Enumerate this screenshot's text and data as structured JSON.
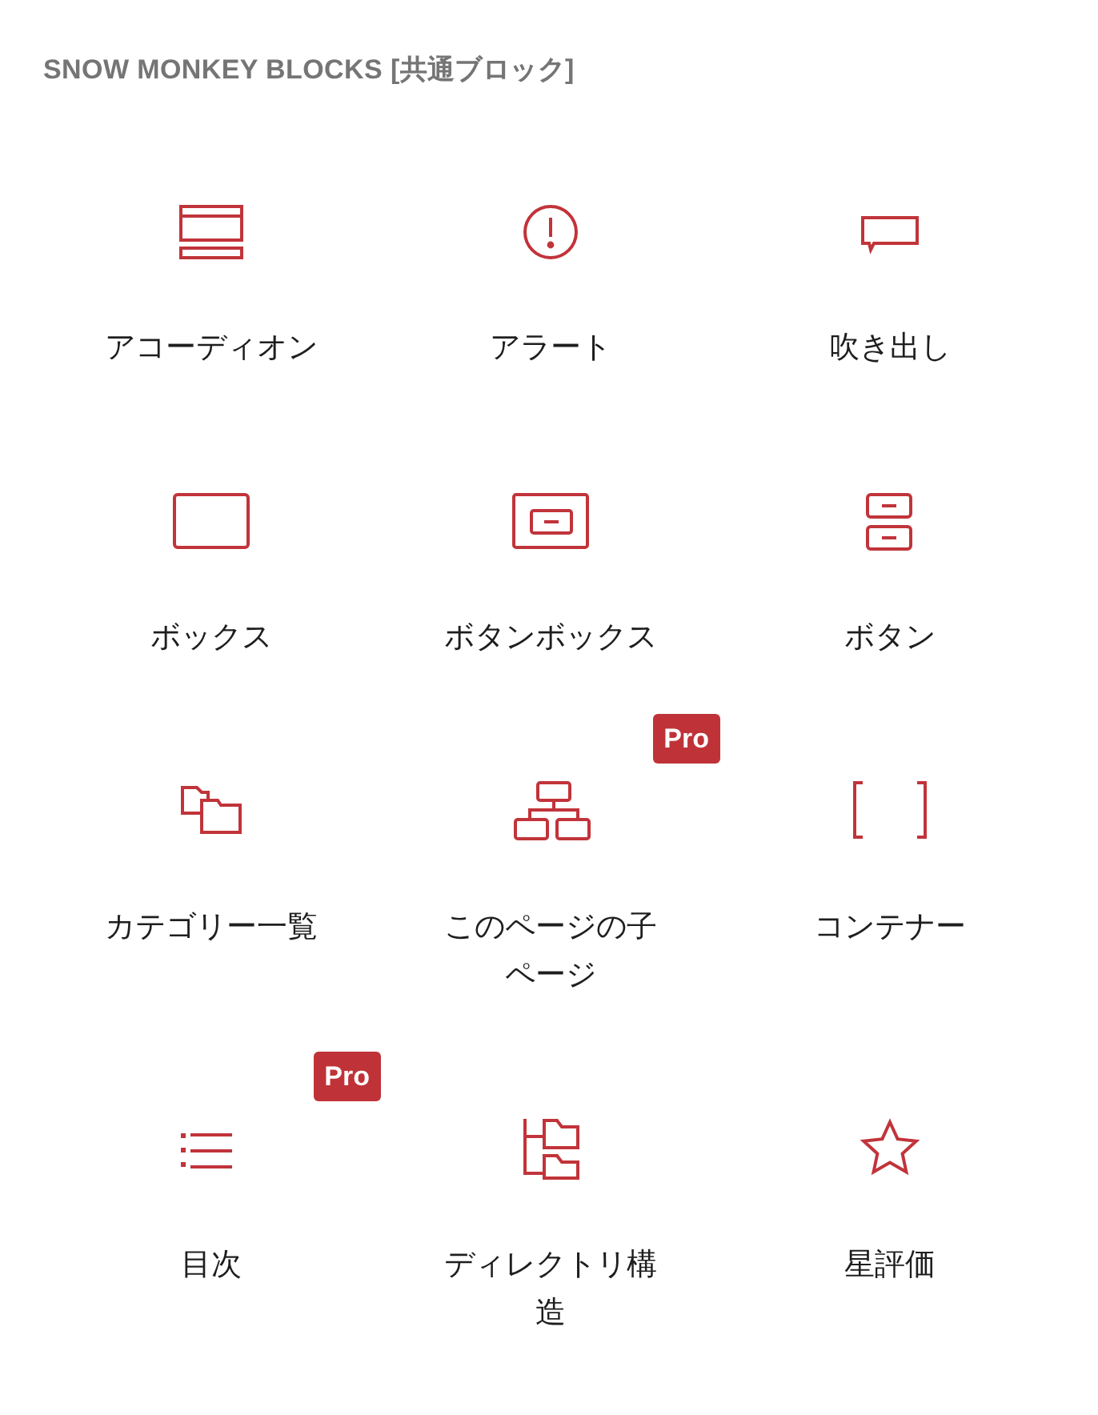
{
  "header": {
    "title": "SNOW MONKEY BLOCKS [共通ブロック]"
  },
  "blocks": [
    {
      "label": "アコーディオン",
      "kind": "accordion"
    },
    {
      "label": "アラート",
      "kind": "alert"
    },
    {
      "label": "吹き出し",
      "kind": "balloon"
    },
    {
      "label": "ボックス",
      "kind": "box"
    },
    {
      "label": "ボタンボックス",
      "kind": "buttonbox"
    },
    {
      "label": "ボタン",
      "kind": "button"
    },
    {
      "label": "カテゴリー一覧",
      "kind": "categories"
    },
    {
      "label": "このページの子ページ",
      "kind": "childpages",
      "badge": "Pro"
    },
    {
      "label": "コンテナー",
      "kind": "container"
    },
    {
      "label": "目次",
      "kind": "toc",
      "badge": "Pro"
    },
    {
      "label": "ディレクトリ構造",
      "kind": "directory"
    },
    {
      "label": "星評価",
      "kind": "rating"
    }
  ]
}
